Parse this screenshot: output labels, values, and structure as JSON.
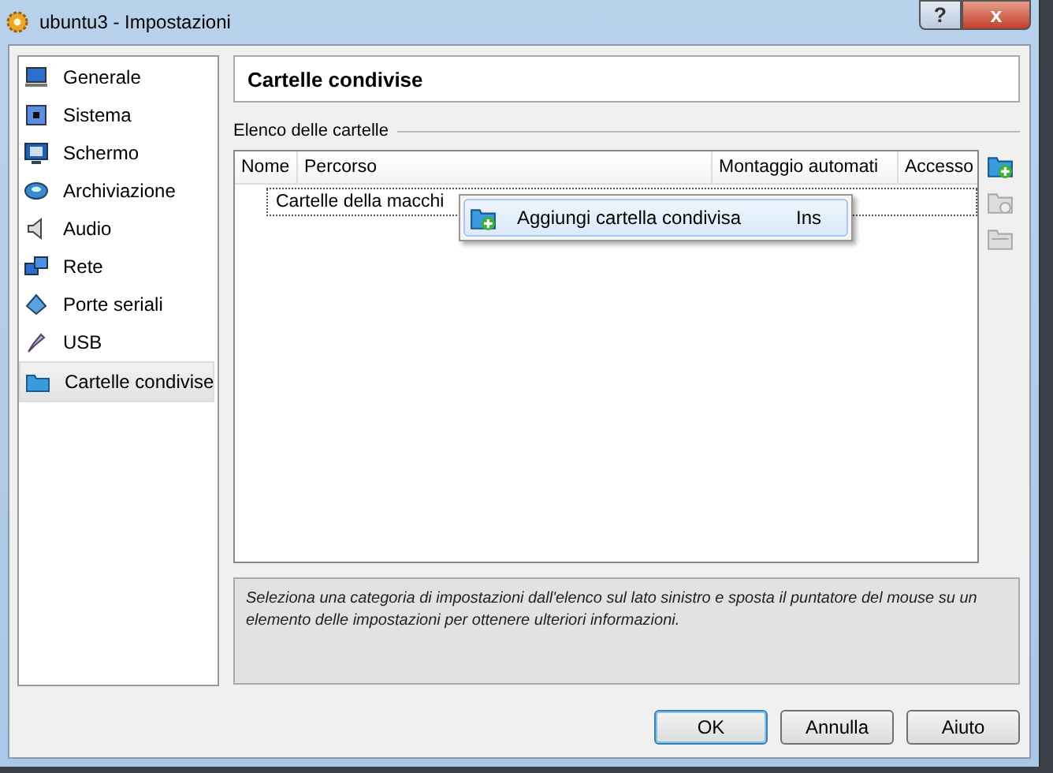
{
  "window": {
    "title": "ubuntu3 - Impostazioni",
    "buttons": [
      "?",
      "x"
    ]
  },
  "sidebar": {
    "items": [
      {
        "label": "Generale",
        "selected": false
      },
      {
        "label": "Sistema",
        "selected": false
      },
      {
        "label": "Schermo",
        "selected": false
      },
      {
        "label": "Archiviazione",
        "selected": false
      },
      {
        "label": "Audio",
        "selected": false
      },
      {
        "label": "Rete",
        "selected": false
      },
      {
        "label": "Porte seriali",
        "selected": false
      },
      {
        "label": "USB",
        "selected": false
      },
      {
        "label": "Cartelle condivise",
        "selected": true
      }
    ]
  },
  "page_title": "Cartelle condivise",
  "folder_list": {
    "label": "Elenco delle cartelle",
    "columns": [
      "Nome",
      "Percorso",
      "Montaggio automati",
      "Accesso"
    ],
    "rows": [
      {
        "label": "Cartelle della macchi"
      }
    ]
  },
  "context_menu": {
    "items": [
      {
        "label": "Aggiungi cartella condivisa",
        "shortcut": "Ins",
        "highlighted": true
      }
    ]
  },
  "info_text": "Seleziona una categoria di impostazioni dall'elenco sul lato sinistro e sposta il puntatore del mouse su un elemento delle impostazioni per ottenere ulteriori informazioni.",
  "buttons": [
    {
      "label": "OK",
      "default": true
    },
    {
      "label": "Annulla",
      "default": false
    },
    {
      "label": "Aiuto",
      "default": false
    }
  ]
}
